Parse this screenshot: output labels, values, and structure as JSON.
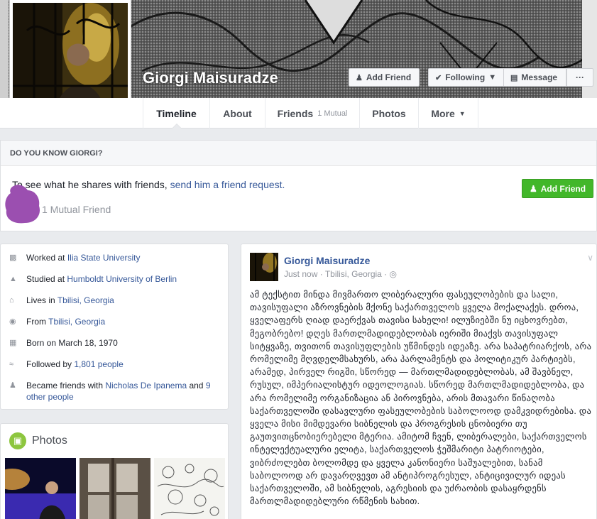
{
  "profile": {
    "name": "Giorgi Maisuradze"
  },
  "cover_actions": {
    "add_friend": "Add Friend",
    "following": "Following",
    "message": "Message",
    "more": "···"
  },
  "nav": {
    "tabs": [
      {
        "label": "Timeline"
      },
      {
        "label": "About"
      },
      {
        "label": "Friends",
        "sub": "1 Mutual"
      },
      {
        "label": "Photos"
      },
      {
        "label": "More"
      }
    ]
  },
  "know": {
    "heading": "DO YOU KNOW GIORGI?",
    "text_prefix": "To see what he shares with friends, ",
    "link": "send him a friend request.",
    "mutual": "1 Mutual Friend",
    "add_friend": "Add Friend"
  },
  "intro": {
    "items": [
      {
        "icon": "briefcase-icon",
        "prefix": "Worked at ",
        "link": "Ilia State University",
        "suffix": ""
      },
      {
        "icon": "graduation-cap-icon",
        "prefix": "Studied at ",
        "link": "Humboldt University of Berlin",
        "suffix": ""
      },
      {
        "icon": "home-icon",
        "prefix": "Lives in ",
        "link": "Tbilisi, Georgia",
        "suffix": ""
      },
      {
        "icon": "location-pin-icon",
        "prefix": "From ",
        "link": "Tbilisi, Georgia",
        "suffix": ""
      },
      {
        "icon": "calendar-icon",
        "prefix": "Born on March 18, 1970",
        "link": "",
        "suffix": ""
      },
      {
        "icon": "rss-icon",
        "prefix": "Followed by ",
        "link": "1,801 people",
        "suffix": ""
      },
      {
        "icon": "friends-icon",
        "prefix": "Became friends with ",
        "link": "Nicholas De Ipanema",
        "suffix": " and ",
        "link2": "9 other people"
      }
    ]
  },
  "photos": {
    "title": "Photos"
  },
  "post": {
    "author": "Giorgi Maisuradze",
    "time": "Just now",
    "location": "Tbilisi, Georgia",
    "body": "ამ ტექსტით მინდა მივმართო ლიბერალური ფასეულობების და სალი, თავისუფალი აზროვნების მქონე საქართველოს ყველა მოქალაქეს. დროა, ყველაფერს ღიად დაერქვას თავისი სახელი! ილუზიებში ნუ იცხოვრებთ, მეგობრებო! დღეს მართლმადიდებლობას იერიში მიაქვს თავისუფალ სიტყვაზე, თვითონ თავისუფლების უწმინდეს იდეაზე. არა საპატრიარქოს, არა რომელიმე მღვდელმსახურს, არა პარლამენტს და პოლიტიკურ პარტიებს, არამედ, პირველ რიგში, სწორედ — მართლმადიდებლობას, ამ შავბნელ, რუსულ, იმპერიალისტურ იდეოლოგიას. სწორედ მართლმადიდებლობა, და არა რომელიმე ორგანიზაცია ან პიროვნება, არის მთავარი წინაღობა საქართველოში დასავლური ფასეულობების საბოლოოდ დამკვიდრებისა. და ყველა მისი მიმდევარი სიბნელის და პროგრესის ცნობიერი თუ გაუთვითცნობიერებელი მტერია. ამიტომ ჩვენ, ლიბერალები, საქართველოს ინტელექტუალური ელიტა, საქართველოს ჭეშმარიტი პატრიოტები, ვიბრძოლებთ ბოლომდე და ყველა კანონიერი საშუალებით, სანამ საბოლოოდ არ დავარღვევთ ამ ანტიპროგრესულ, ანტიცივილურ იდეას საქართველოში, ამ სიბნელის, აგრესიის და უძრაობის დასაყრდენს მართლმადიდებლური რწმენის სახით."
  },
  "colors": {
    "link": "#365899",
    "green": "#42b72a",
    "accent_blob": "#9b59b6"
  }
}
